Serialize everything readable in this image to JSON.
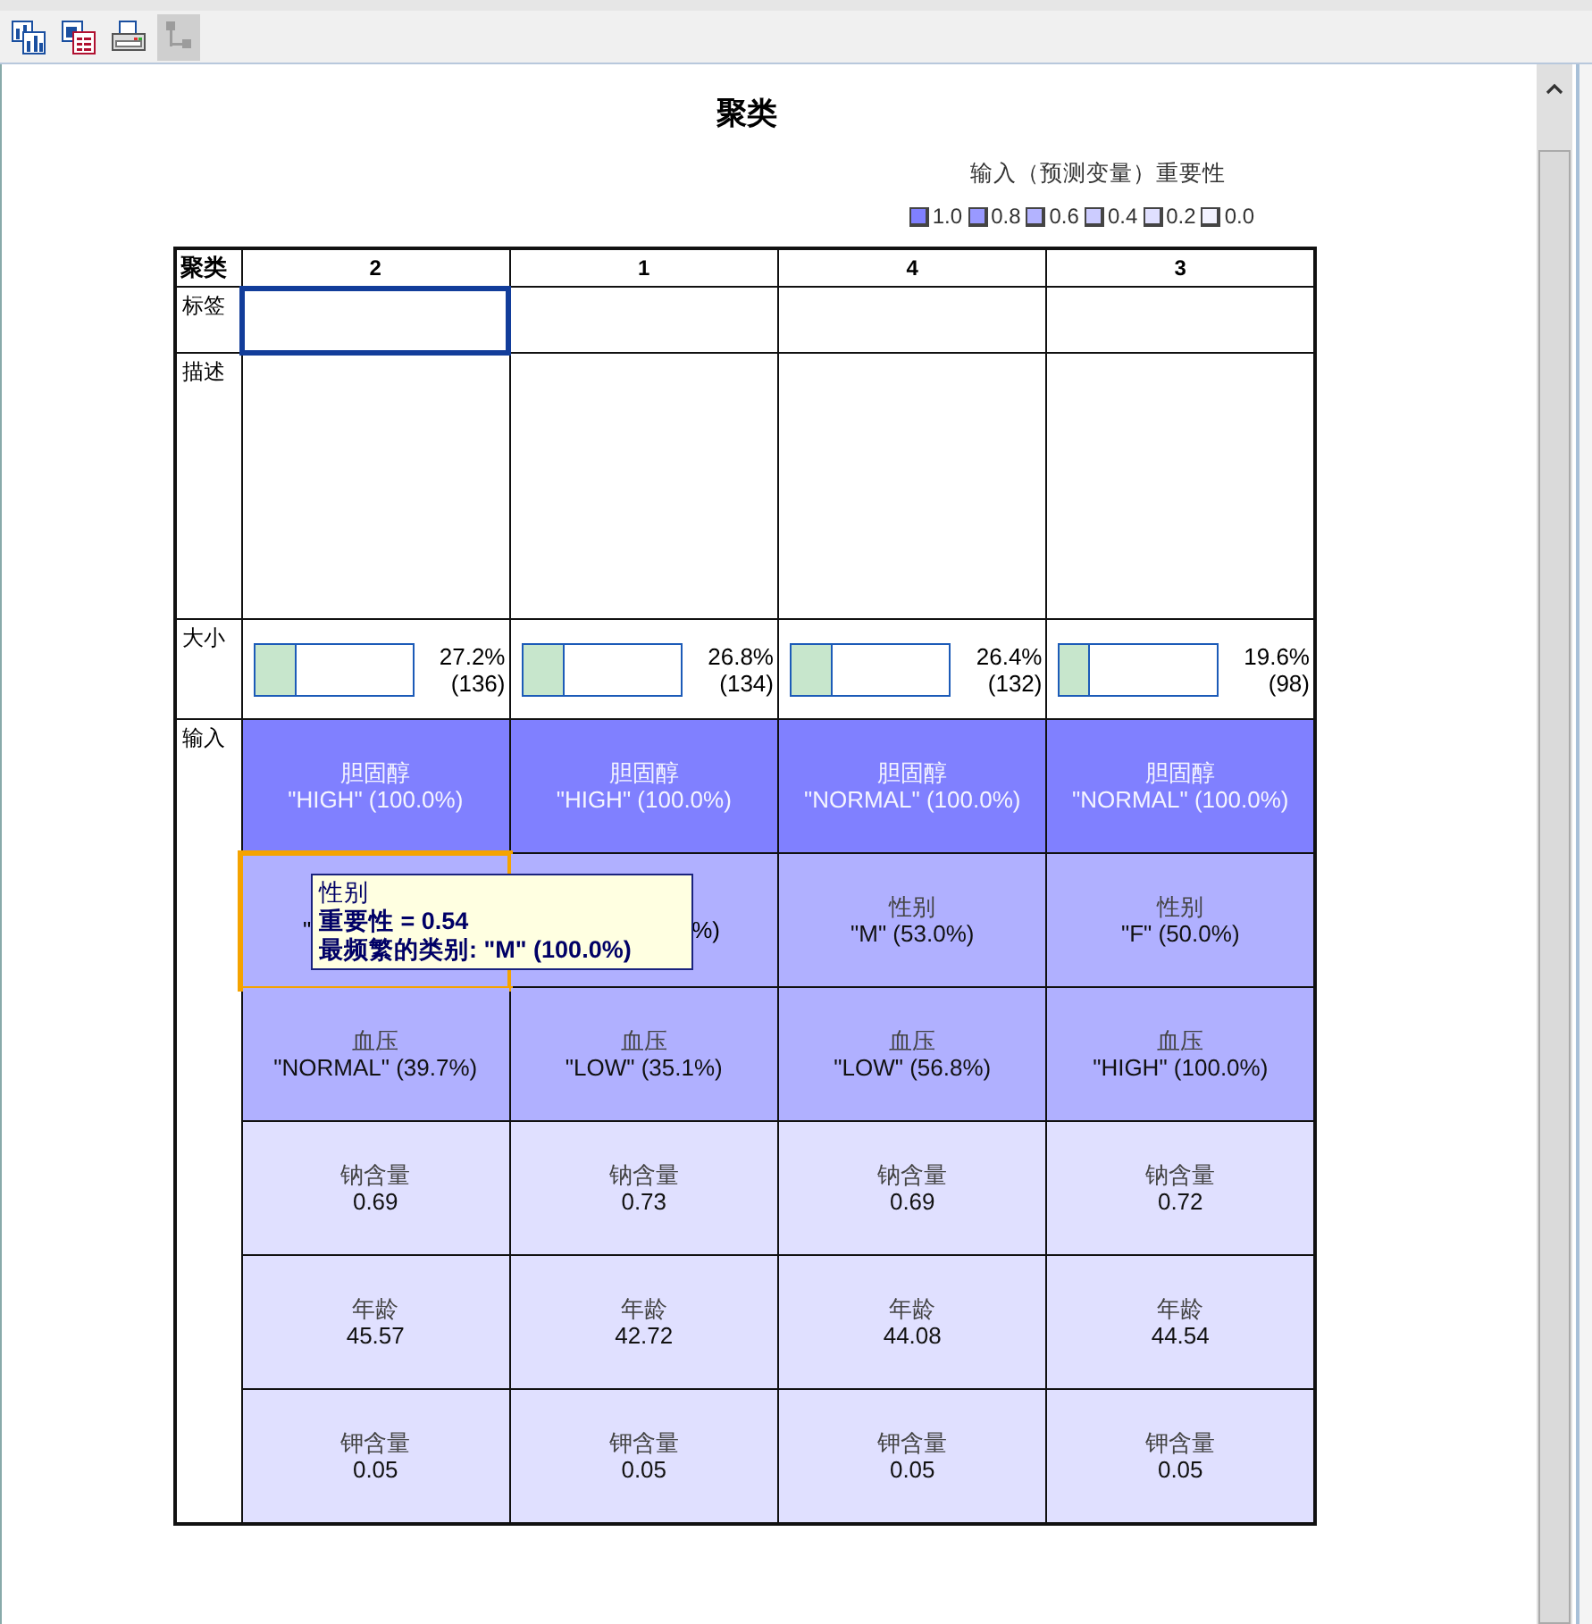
{
  "toolbar": [
    {
      "kind": "charts",
      "disabled": false
    },
    {
      "kind": "table",
      "disabled": false
    },
    {
      "kind": "printer",
      "disabled": false
    },
    {
      "kind": "tree",
      "disabled": true
    }
  ],
  "title": "聚类",
  "legend": {
    "title": "输入（预测变量）重要性",
    "items": [
      {
        "label": "1.0",
        "color": "#8080ff"
      },
      {
        "label": "0.8",
        "color": "#9999ff"
      },
      {
        "label": "0.6",
        "color": "#b3b3ff"
      },
      {
        "label": "0.4",
        "color": "#ccccff"
      },
      {
        "label": "0.2",
        "color": "#e0e0ff"
      },
      {
        "label": "0.0",
        "color": "#f2f2ff"
      }
    ]
  },
  "table": {
    "corner": "聚类",
    "columns": [
      {
        "label": "2"
      },
      {
        "label": "1"
      },
      {
        "label": "4"
      },
      {
        "label": "3"
      }
    ],
    "row_labels": {
      "label": "标签",
      "description": "描述",
      "size": "大小",
      "inputs": "输入"
    },
    "label_cells": [
      {
        "selected": true
      },
      {
        "selected": false
      },
      {
        "selected": false
      },
      {
        "selected": false
      }
    ],
    "sizes": [
      {
        "level": 0.272,
        "percent": "27.2%",
        "count": "(136)"
      },
      {
        "level": 0.268,
        "percent": "26.8%",
        "count": "(134)"
      },
      {
        "level": 0.264,
        "percent": "26.4%",
        "count": "(132)"
      },
      {
        "level": 0.196,
        "percent": "19.6%",
        "count": "(98)"
      }
    ],
    "input_rows": [
      {
        "color": "#8080ff",
        "cells": [
          {
            "kind": "full",
            "name": "胆固醇",
            "value": "\"HIGH\" (100.0%)",
            "highlighted": false
          },
          {
            "kind": "full",
            "name": "胆固醇",
            "value": "\"HIGH\" (100.0%)",
            "highlighted": false
          },
          {
            "kind": "full",
            "name": "胆固醇",
            "value": "\"NORMAL\" (100.0%)",
            "highlighted": false
          },
          {
            "kind": "full",
            "name": "胆固醇",
            "value": "\"NORMAL\" (100.0%)",
            "highlighted": false
          }
        ]
      },
      {
        "color": "#b0b0ff",
        "cells": [
          {
            "kind": "left-fragment",
            "value": "\"",
            "highlighted": true
          },
          {
            "kind": "right-fragment",
            "value": "%)",
            "highlighted": false
          },
          {
            "kind": "full",
            "name": "性别",
            "value": "\"M\" (53.0%)",
            "highlighted": false
          },
          {
            "kind": "full",
            "name": "性别",
            "value": "\"F\" (50.0%)",
            "highlighted": false
          }
        ]
      },
      {
        "color": "#b0b0ff",
        "cells": [
          {
            "kind": "full",
            "name": "血压",
            "value": "\"NORMAL\" (39.7%)",
            "highlighted": false
          },
          {
            "kind": "full",
            "name": "血压",
            "value": "\"LOW\" (35.1%)",
            "highlighted": false
          },
          {
            "kind": "full",
            "name": "血压",
            "value": "\"LOW\" (56.8%)",
            "highlighted": false
          },
          {
            "kind": "full",
            "name": "血压",
            "value": "\"HIGH\" (100.0%)",
            "highlighted": false
          }
        ]
      },
      {
        "color": "#e0e0ff",
        "cells": [
          {
            "kind": "full",
            "name": "钠含量",
            "value": "0.69",
            "highlighted": false
          },
          {
            "kind": "full",
            "name": "钠含量",
            "value": "0.73",
            "highlighted": false
          },
          {
            "kind": "full",
            "name": "钠含量",
            "value": "0.69",
            "highlighted": false
          },
          {
            "kind": "full",
            "name": "钠含量",
            "value": "0.72",
            "highlighted": false
          }
        ]
      },
      {
        "color": "#e0e0ff",
        "cells": [
          {
            "kind": "full",
            "name": "年龄",
            "value": "45.57",
            "highlighted": false
          },
          {
            "kind": "full",
            "name": "年龄",
            "value": "42.72",
            "highlighted": false
          },
          {
            "kind": "full",
            "name": "年龄",
            "value": "44.08",
            "highlighted": false
          },
          {
            "kind": "full",
            "name": "年龄",
            "value": "44.54",
            "highlighted": false
          }
        ]
      },
      {
        "color": "#e0e0ff",
        "cells": [
          {
            "kind": "full",
            "name": "钾含量",
            "value": "0.05",
            "highlighted": false
          },
          {
            "kind": "full",
            "name": "钾含量",
            "value": "0.05",
            "highlighted": false
          },
          {
            "kind": "full",
            "name": "钾含量",
            "value": "0.05",
            "highlighted": false
          },
          {
            "kind": "full",
            "name": "钾含量",
            "value": "0.05",
            "highlighted": false
          }
        ]
      }
    ]
  },
  "tooltip": {
    "title": "性别",
    "importance": "重要性 = 0.54",
    "category": "最频繁的类别: \"M\" (100.0%)"
  }
}
